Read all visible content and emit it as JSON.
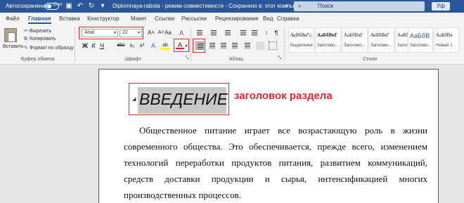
{
  "titlebar": {
    "autosave_label": "Автосохранение",
    "autosave_state": "Откл",
    "document_title": "Diplomnaya-rabota  -  режим совместимости  -  Сохранено в: этот компьютер",
    "search_placeholder": "Поиск",
    "share_label": "Уф",
    "accent": "#2b579a"
  },
  "menu": {
    "tabs": [
      "Файл",
      "Главная",
      "Вставка",
      "Конструктор",
      "Макет",
      "Ссылки",
      "Рассылки",
      "Рецензирование",
      "Вид",
      "Справка"
    ],
    "active_tab": "Главная"
  },
  "ribbon": {
    "clipboard": {
      "paste_label": "Вставить",
      "cut_label": "Вырезать",
      "copy_label": "Копировать",
      "format_painter_label": "Формат по образцу",
      "group_label": "Буфер обмена"
    },
    "font": {
      "font_name": "Arial",
      "font_size": "22",
      "grow_label": "A˄",
      "shrink_label": "A˅",
      "case_label": "Aa",
      "clear_label": "A",
      "bold_label": "Ж",
      "italic_label": "К",
      "underline_label": "Ч",
      "strike_label": "abc",
      "subscript_label": "x₂",
      "superscript_label": "x²",
      "effects_label": "A",
      "highlight_label": "ab",
      "color_label": "A",
      "group_label": "Шрифт"
    },
    "paragraph": {
      "group_label": "Абзац",
      "marks_label": "¶"
    },
    "styles": {
      "group_label": "Стили",
      "items": [
        {
          "sample": "АаБбВвГг,",
          "name": "Выделение"
        },
        {
          "sample": "АаБбВвГ",
          "name": "Заголово..."
        },
        {
          "sample": "АаБбВвГ",
          "name": "Заголово..."
        },
        {
          "sample": "АаБбВвГ",
          "name": "Заголово..."
        },
        {
          "sample": "АаБбВвГ",
          "name": "Заголово..."
        },
        {
          "sample": "АаБбВ",
          "name": "Заголово..."
        },
        {
          "sample": "АаБбВв",
          "name": "Новый 1"
        }
      ]
    }
  },
  "document": {
    "heading": "ВВЕДЕНИЕ",
    "annotation": "заголовок раздела",
    "annotation_color": "#e3262d",
    "lines": [
      "Общественное питание играет все возрастающую роль в жизни",
      "современного общества. Это обеспечивается, прежде всего, изменением",
      "технологий переработки продуктов питания, развитием коммуникаций,",
      "средств доставки продукции и сырья, интенсификацией многих",
      "производственных процессов."
    ]
  }
}
